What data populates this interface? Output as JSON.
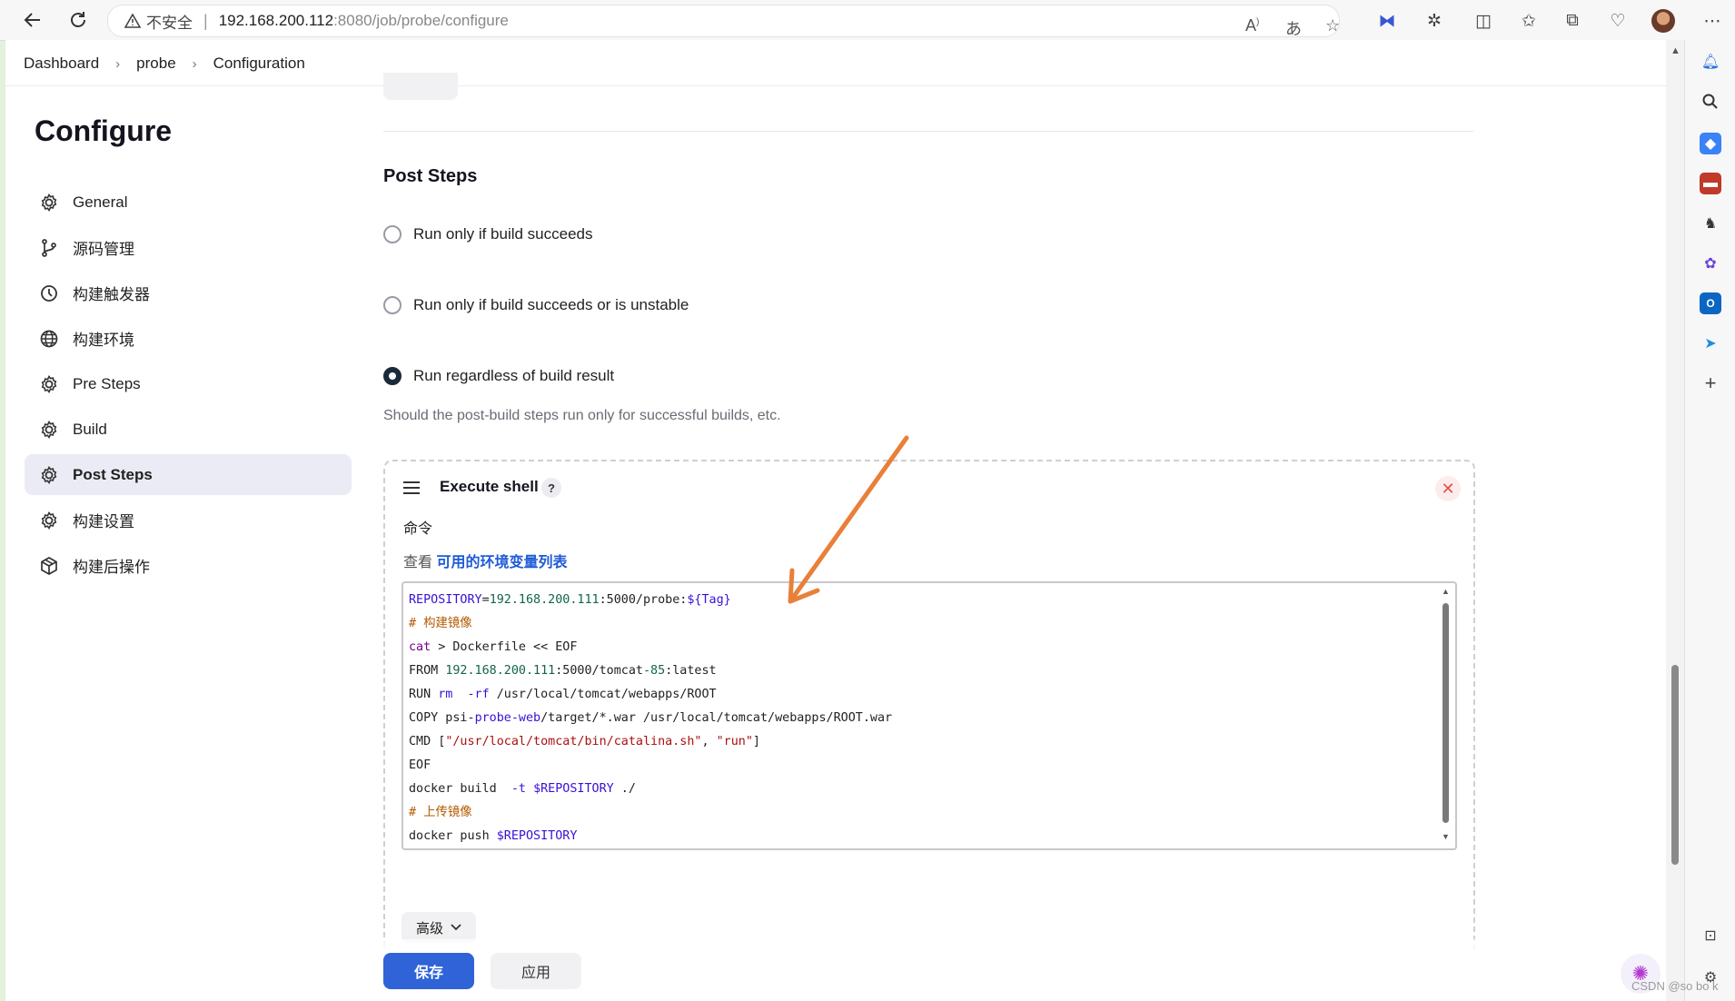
{
  "browser": {
    "security_label": "不安全",
    "url_host": "192.168.200.112",
    "url_path": ":8080/job/probe/configure"
  },
  "breadcrumb": [
    "Dashboard",
    "probe",
    "Configuration"
  ],
  "page_title": "Configure",
  "sidebar": {
    "items": [
      {
        "label": "General",
        "icon": "gear-icon"
      },
      {
        "label": "源码管理",
        "icon": "branch-icon"
      },
      {
        "label": "构建触发器",
        "icon": "clock-icon"
      },
      {
        "label": "构建环境",
        "icon": "globe-icon"
      },
      {
        "label": "Pre Steps",
        "icon": "gear-icon"
      },
      {
        "label": "Build",
        "icon": "gear-icon"
      },
      {
        "label": "Post Steps",
        "icon": "gear-icon",
        "active": true
      },
      {
        "label": "构建设置",
        "icon": "gear-icon"
      },
      {
        "label": "构建后操作",
        "icon": "cube-icon"
      }
    ]
  },
  "post_steps": {
    "title": "Post Steps",
    "options": [
      {
        "label": "Run only if build succeeds",
        "checked": false
      },
      {
        "label": "Run only if build succeeds or is unstable",
        "checked": false
      },
      {
        "label": "Run regardless of build result",
        "checked": true
      }
    ],
    "help": "Should the post-build steps run only for successful builds, etc."
  },
  "execute_shell": {
    "title": "Execute shell",
    "help_label": "?",
    "close_label": "✕",
    "command_label": "命令",
    "env_prefix": "查看",
    "env_link": "可用的环境变量列表",
    "code_lines": [
      "REPOSITORY=192.168.200.111:5000/probe:${Tag}",
      "# 构建镜像",
      "cat > Dockerfile << EOF",
      "FROM 192.168.200.111:5000/tomcat-85:latest",
      "RUN rm -rf /usr/local/tomcat/webapps/ROOT",
      "COPY psi-probe-web/target/*.war /usr/local/tomcat/webapps/ROOT.war",
      "CMD [\"/usr/local/tomcat/bin/catalina.sh\", \"run\"]",
      "EOF",
      "docker build -t $REPOSITORY ./",
      "# 上传镜像",
      "docker push $REPOSITORY"
    ],
    "advanced_label": "高级"
  },
  "buttons": {
    "save": "保存",
    "apply": "应用"
  },
  "watermark": "CSDN @so bo k",
  "colors": {
    "primary": "#2f63d7",
    "annotation_arrow": "#e8803a",
    "link": "#1e5bd6"
  }
}
